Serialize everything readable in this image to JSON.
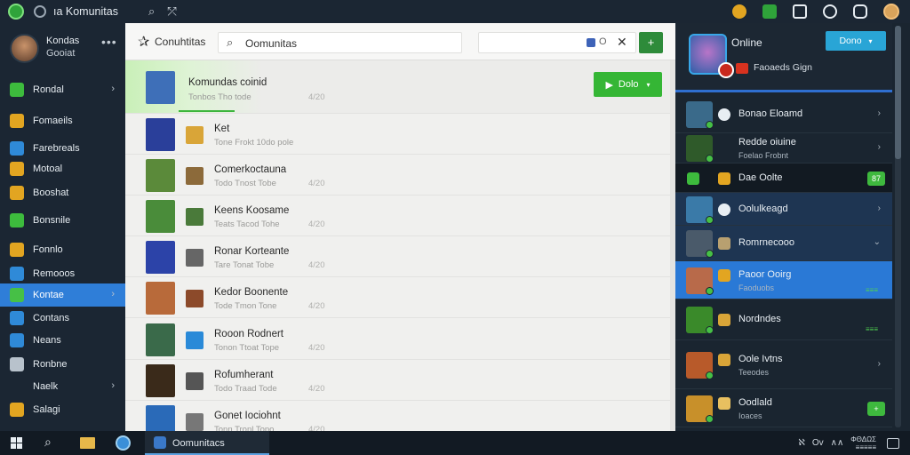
{
  "topbar": {
    "title": "ıa Komunitas",
    "search_icon": "search-icon",
    "pin_icon": "pin-icon",
    "right_icons": [
      "#e2a521",
      "#2fa33a",
      "#e8eef3",
      "#e8eef3",
      "#e8eef3"
    ]
  },
  "sidebar": {
    "profile": {
      "name": "Kondas",
      "status": "Gooiat",
      "menu": "•••"
    },
    "items": [
      {
        "label": "Rondal",
        "icon_color": "#3dbb3d",
        "chevron": "›"
      },
      {
        "label": "Fomaeils",
        "icon_color": "#e2a521",
        "chevron": ""
      },
      {
        "label": "Farebreals",
        "icon_color": "#2f8ad8",
        "chevron": ""
      },
      {
        "label": "Motoal",
        "icon_color": "#e2a521",
        "chevron": ""
      },
      {
        "label": "Booshat",
        "icon_color": "#e2a521",
        "chevron": ""
      },
      {
        "label": "Bonsnile",
        "icon_color": "#3dbb3d",
        "chevron": ""
      },
      {
        "label": "Fonnlo",
        "icon_color": "#e2a521",
        "chevron": ""
      },
      {
        "label": "Remooos",
        "icon_color": "#2f8ad8",
        "chevron": ""
      },
      {
        "label": "Kontae",
        "icon_color": "#46c046",
        "chevron": "›"
      },
      {
        "label": "Contans",
        "icon_color": "#2f8ad8",
        "chevron": ""
      },
      {
        "label": "Neans",
        "icon_color": "#2f8ad8",
        "chevron": ""
      },
      {
        "label": "Ronbne",
        "icon_color": "#b8c2cc",
        "chevron": ""
      },
      {
        "label": "Naelk",
        "icon_color": "",
        "chevron": "›"
      },
      {
        "label": "Salagi",
        "icon_color": "#e2a521",
        "chevron": ""
      }
    ]
  },
  "main": {
    "header_title": "Conuhtitas",
    "search_value": "Oomunitas",
    "filter_o": "O",
    "filter_x": "✕",
    "add_label": "+",
    "rows": [
      {
        "title": "Komundas coinid",
        "sub": "Tonbos Tho tode",
        "num": "4/20",
        "thumb": "#3e6fb8",
        "mini": ""
      },
      {
        "title": "Ket",
        "sub": "Tone Frokt 10do pole",
        "num": "",
        "thumb": "#2a3f9a",
        "mini": "#d9a538"
      },
      {
        "title": "Comerkoctauna",
        "sub": "Todo Tnost Tobe",
        "num": "4/20",
        "thumb": "#5b8a3a",
        "mini": "#8c6a3a"
      },
      {
        "title": "Keens Koosame",
        "sub": "Teats Tacod Tohe",
        "num": "4/20",
        "thumb": "#4a8c3a",
        "mini": "#4a7a3a"
      },
      {
        "title": "Ronar Korteante",
        "sub": "Tare Tonat Tobe",
        "num": "4/20",
        "thumb": "#2c43a8",
        "mini": "#666666"
      },
      {
        "title": "Kedor Boonente",
        "sub": "Tode Tmon Tone",
        "num": "4/20",
        "thumb": "#b86a3a",
        "mini": "#8c4a2a"
      },
      {
        "title": "Rooon Rodnert",
        "sub": "Tonon Ttoat Tope",
        "num": "4/20",
        "thumb": "#3a6a4a",
        "mini": "#2a8ad8"
      },
      {
        "title": "Rofumherant",
        "sub": "Todo Traad Tode",
        "num": "4/20",
        "thumb": "#3a2a1a",
        "mini": "#555555"
      },
      {
        "title": "Gonet Iociohnt",
        "sub": "Tonn Tronl Topo",
        "num": "4/20",
        "thumb": "#2a6ab8",
        "mini": "#777777"
      }
    ],
    "row_button": {
      "label": "Dolo",
      "dropdown": "▾"
    }
  },
  "right_panel": {
    "status": "Online",
    "user_line": "Faoaeds Gign",
    "header_button": "Dono",
    "items": [
      {
        "name": "Bonao Eloamd",
        "sub": "",
        "chevron": "›",
        "style": "",
        "avatar": "#3a6a8a",
        "icon": "#e8eef3",
        "green": "",
        "btn": ""
      },
      {
        "name": "Redde oiuine",
        "sub": "Foelao Frobnt",
        "chevron": "›",
        "style": "",
        "avatar": "#2f5a2a",
        "icon": "",
        "green": "",
        "btn": ""
      },
      {
        "name": "Dae Oolte",
        "sub": "",
        "chevron": "",
        "style": "black",
        "avatar": "",
        "icon": "#e2a521",
        "green": "",
        "btn": "87"
      },
      {
        "name": "Oolulkeagd",
        "sub": "",
        "chevron": "›",
        "style": "darkblue",
        "avatar": "#3a7aa8",
        "icon": "#e8eef3",
        "green": "",
        "btn": ""
      },
      {
        "name": "Romrnecooo",
        "sub": "",
        "chevron": "⌄",
        "style": "darkblue",
        "avatar": "#4a5a6a",
        "icon": "#b8a070",
        "green": "",
        "btn": ""
      },
      {
        "name": "Paoor Ooirg",
        "sub": "Faoduobs",
        "chevron": "",
        "style": "blue",
        "avatar": "#b86a4a",
        "icon": "#e2a521",
        "green": "≡≡≡",
        "btn": ""
      },
      {
        "name": "Nordndes",
        "sub": "",
        "chevron": "",
        "style": "",
        "avatar": "#3a8a2a",
        "icon": "#d9a538",
        "green": "≡≡≡",
        "btn": ""
      },
      {
        "name": "Oole Ivtns",
        "sub": "Teeodes",
        "chevron": "›",
        "style": "",
        "avatar": "#b85a2a",
        "icon": "#d9a538",
        "green": "",
        "btn": ""
      },
      {
        "name": "Oodlald",
        "sub": "Ioaces",
        "chevron": "",
        "style": "",
        "avatar": "#c8902a",
        "icon": "#e8c060",
        "green": "",
        "btn": "+"
      }
    ]
  },
  "taskbar": {
    "app_label": "Oomunitacs",
    "tray": [
      "ℵ",
      "Ov",
      "∧∧"
    ],
    "clock_top": "ΦΘΔΩΣ",
    "clock_bottom": "≡≡≡≡≡"
  }
}
